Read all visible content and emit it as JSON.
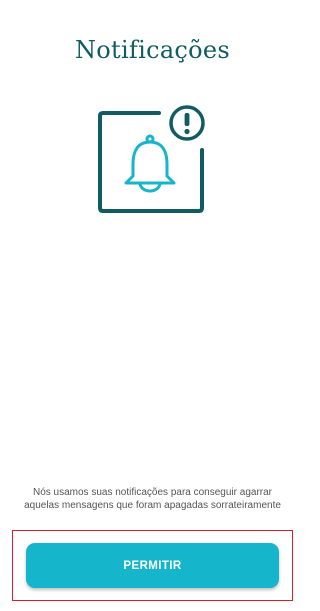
{
  "screen": {
    "title": "Notificações",
    "description": "Nós usamos suas notificações para conseguir agarrar aquelas mensagens que foram apagadas sorrateiramente",
    "button_label": "PERMITIR"
  },
  "illustration": {
    "icon": "bell-notification-icon",
    "badge_icon": "exclamation-icon",
    "frame_color": "#115c63",
    "bell_color": "#16b5c9"
  },
  "colors": {
    "title": "#0f5c63",
    "button": "#15b5cc",
    "highlight_frame": "#d91e2a"
  }
}
